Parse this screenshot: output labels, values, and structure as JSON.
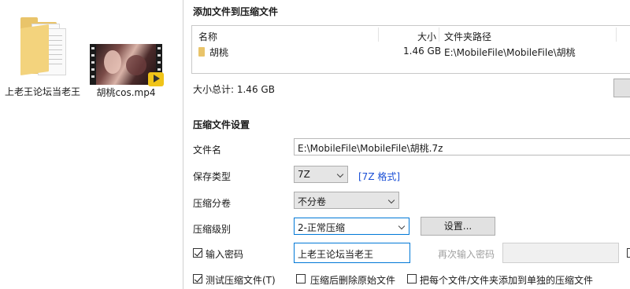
{
  "desktop": {
    "folder": {
      "label": "上老王论坛当老王",
      "icon": "folder-icon"
    },
    "video": {
      "label": "胡桃cos.mp4",
      "icon": "video-file-icon",
      "badge_icon": "player-icon"
    }
  },
  "dialog": {
    "files_section": {
      "title": "添加文件到压缩文件",
      "columns": {
        "name": "名称",
        "size": "大小",
        "path": "文件夹路径"
      },
      "rows": [
        {
          "icon": "folder-icon",
          "name": "胡桃",
          "size": "1.46 GB",
          "path": "E:\\MobileFile\\MobileFile\\胡桃"
        }
      ],
      "total_label": "大小总计: 1.46 GB"
    },
    "settings": {
      "title": "压缩文件设置",
      "filename_label": "文件名",
      "filename_value": "E:\\MobileFile\\MobileFile\\胡桃.7z",
      "save_type_label": "保存类型",
      "save_type_value": "7Z",
      "format_link": "[7Z 格式]",
      "split_label": "压缩分卷",
      "split_value": "不分卷",
      "level_label": "压缩级别",
      "level_value": "2-正常压缩",
      "settings_button": "设置...",
      "password_checkbox": {
        "label": "输入密码",
        "checked": true
      },
      "password_value": "上老王论坛当老王",
      "repeat_password_label": "再次输入密码",
      "repeat_password_value": "",
      "test_checkbox": {
        "label": "测试压缩文件(T)",
        "checked": true
      },
      "delete_checkbox": {
        "label": "压缩后删除原始文件",
        "checked": false
      },
      "separate_checkbox": {
        "label": "把每个文件/文件夹添加到单独的压缩文件",
        "checked": false
      }
    }
  }
}
